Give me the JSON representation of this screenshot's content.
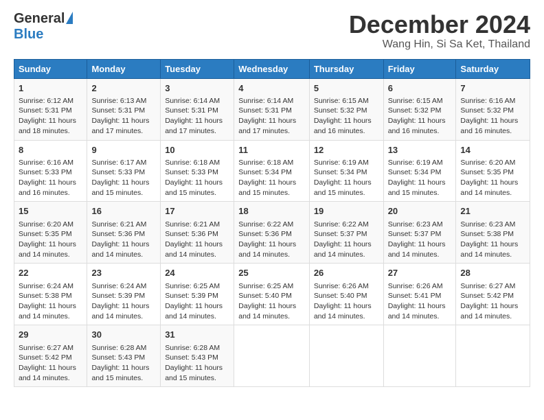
{
  "logo": {
    "general": "General",
    "blue": "Blue"
  },
  "title": {
    "month": "December 2024",
    "location": "Wang Hin, Si Sa Ket, Thailand"
  },
  "weekdays": [
    "Sunday",
    "Monday",
    "Tuesday",
    "Wednesday",
    "Thursday",
    "Friday",
    "Saturday"
  ],
  "weeks": [
    [
      {
        "day": "1",
        "sunrise": "6:12 AM",
        "sunset": "5:31 PM",
        "daylight": "11 hours and 18 minutes."
      },
      {
        "day": "2",
        "sunrise": "6:13 AM",
        "sunset": "5:31 PM",
        "daylight": "11 hours and 17 minutes."
      },
      {
        "day": "3",
        "sunrise": "6:14 AM",
        "sunset": "5:31 PM",
        "daylight": "11 hours and 17 minutes."
      },
      {
        "day": "4",
        "sunrise": "6:14 AM",
        "sunset": "5:31 PM",
        "daylight": "11 hours and 17 minutes."
      },
      {
        "day": "5",
        "sunrise": "6:15 AM",
        "sunset": "5:32 PM",
        "daylight": "11 hours and 16 minutes."
      },
      {
        "day": "6",
        "sunrise": "6:15 AM",
        "sunset": "5:32 PM",
        "daylight": "11 hours and 16 minutes."
      },
      {
        "day": "7",
        "sunrise": "6:16 AM",
        "sunset": "5:32 PM",
        "daylight": "11 hours and 16 minutes."
      }
    ],
    [
      {
        "day": "8",
        "sunrise": "6:16 AM",
        "sunset": "5:33 PM",
        "daylight": "11 hours and 16 minutes."
      },
      {
        "day": "9",
        "sunrise": "6:17 AM",
        "sunset": "5:33 PM",
        "daylight": "11 hours and 15 minutes."
      },
      {
        "day": "10",
        "sunrise": "6:18 AM",
        "sunset": "5:33 PM",
        "daylight": "11 hours and 15 minutes."
      },
      {
        "day": "11",
        "sunrise": "6:18 AM",
        "sunset": "5:34 PM",
        "daylight": "11 hours and 15 minutes."
      },
      {
        "day": "12",
        "sunrise": "6:19 AM",
        "sunset": "5:34 PM",
        "daylight": "11 hours and 15 minutes."
      },
      {
        "day": "13",
        "sunrise": "6:19 AM",
        "sunset": "5:34 PM",
        "daylight": "11 hours and 15 minutes."
      },
      {
        "day": "14",
        "sunrise": "6:20 AM",
        "sunset": "5:35 PM",
        "daylight": "11 hours and 14 minutes."
      }
    ],
    [
      {
        "day": "15",
        "sunrise": "6:20 AM",
        "sunset": "5:35 PM",
        "daylight": "11 hours and 14 minutes."
      },
      {
        "day": "16",
        "sunrise": "6:21 AM",
        "sunset": "5:36 PM",
        "daylight": "11 hours and 14 minutes."
      },
      {
        "day": "17",
        "sunrise": "6:21 AM",
        "sunset": "5:36 PM",
        "daylight": "11 hours and 14 minutes."
      },
      {
        "day": "18",
        "sunrise": "6:22 AM",
        "sunset": "5:36 PM",
        "daylight": "11 hours and 14 minutes."
      },
      {
        "day": "19",
        "sunrise": "6:22 AM",
        "sunset": "5:37 PM",
        "daylight": "11 hours and 14 minutes."
      },
      {
        "day": "20",
        "sunrise": "6:23 AM",
        "sunset": "5:37 PM",
        "daylight": "11 hours and 14 minutes."
      },
      {
        "day": "21",
        "sunrise": "6:23 AM",
        "sunset": "5:38 PM",
        "daylight": "11 hours and 14 minutes."
      }
    ],
    [
      {
        "day": "22",
        "sunrise": "6:24 AM",
        "sunset": "5:38 PM",
        "daylight": "11 hours and 14 minutes."
      },
      {
        "day": "23",
        "sunrise": "6:24 AM",
        "sunset": "5:39 PM",
        "daylight": "11 hours and 14 minutes."
      },
      {
        "day": "24",
        "sunrise": "6:25 AM",
        "sunset": "5:39 PM",
        "daylight": "11 hours and 14 minutes."
      },
      {
        "day": "25",
        "sunrise": "6:25 AM",
        "sunset": "5:40 PM",
        "daylight": "11 hours and 14 minutes."
      },
      {
        "day": "26",
        "sunrise": "6:26 AM",
        "sunset": "5:40 PM",
        "daylight": "11 hours and 14 minutes."
      },
      {
        "day": "27",
        "sunrise": "6:26 AM",
        "sunset": "5:41 PM",
        "daylight": "11 hours and 14 minutes."
      },
      {
        "day": "28",
        "sunrise": "6:27 AM",
        "sunset": "5:42 PM",
        "daylight": "11 hours and 14 minutes."
      }
    ],
    [
      {
        "day": "29",
        "sunrise": "6:27 AM",
        "sunset": "5:42 PM",
        "daylight": "11 hours and 14 minutes."
      },
      {
        "day": "30",
        "sunrise": "6:28 AM",
        "sunset": "5:43 PM",
        "daylight": "11 hours and 15 minutes."
      },
      {
        "day": "31",
        "sunrise": "6:28 AM",
        "sunset": "5:43 PM",
        "daylight": "11 hours and 15 minutes."
      },
      null,
      null,
      null,
      null
    ]
  ],
  "labels": {
    "sunrise": "Sunrise:",
    "sunset": "Sunset:",
    "daylight": "Daylight:"
  }
}
